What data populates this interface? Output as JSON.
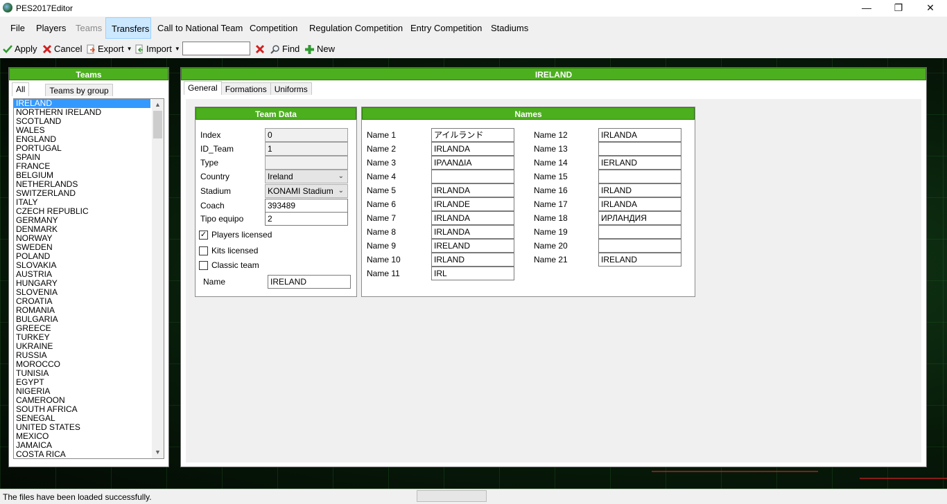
{
  "window": {
    "title": "PES2017Editor",
    "minimize": "—",
    "restore": "❐",
    "close": "✕"
  },
  "menu": {
    "file": "File",
    "players": "Players",
    "teams": "Teams",
    "transfers": "Transfers",
    "call_national": "Call to National Team",
    "competition": "Competition",
    "regulation": "Regulation Competition",
    "entry": "Entry Competition",
    "stadiums": "Stadiums"
  },
  "toolbar": {
    "apply": "Apply",
    "cancel": "Cancel",
    "export": "Export",
    "import": "Import",
    "search_value": "",
    "find": "Find",
    "new": "New"
  },
  "colors": {
    "accent": "#4caf1e",
    "selection": "#3399ff",
    "apply_icon": "#2e9a2e",
    "cancel_icon": "#d21f1f"
  },
  "teams_panel": {
    "title": "Teams",
    "tabs": [
      "All",
      "Teams by group"
    ],
    "items": [
      "IRELAND",
      "NORTHERN IRELAND",
      "SCOTLAND",
      "WALES",
      "ENGLAND",
      "PORTUGAL",
      "SPAIN",
      "FRANCE",
      "BELGIUM",
      "NETHERLANDS",
      "SWITZERLAND",
      "ITALY",
      "CZECH REPUBLIC",
      "GERMANY",
      "DENMARK",
      "NORWAY",
      "SWEDEN",
      "POLAND",
      "SLOVAKIA",
      "AUSTRIA",
      "HUNGARY",
      "SLOVENIA",
      "CROATIA",
      "ROMANIA",
      "BULGARIA",
      "GREECE",
      "TURKEY",
      "UKRAINE",
      "RUSSIA",
      "MOROCCO",
      "TUNISIA",
      "EGYPT",
      "NIGERIA",
      "CAMEROON",
      "SOUTH AFRICA",
      "SENEGAL",
      "UNITED STATES",
      "MEXICO",
      "JAMAICA",
      "COSTA RICA"
    ],
    "selected_index": 0
  },
  "main_panel": {
    "title": "IRELAND",
    "tabs": [
      "General",
      "Formations",
      "Uniforms"
    ]
  },
  "team_data": {
    "title": "Team Data",
    "index_label": "Index",
    "index_value": "0",
    "id_label": "ID_Team",
    "id_value": "1",
    "type_label": "Type",
    "type_value": "",
    "country_label": "Country",
    "country_value": "Ireland",
    "stadium_label": "Stadium",
    "stadium_value": "KONAMI Stadium",
    "coach_label": "Coach",
    "coach_value": "393489",
    "tipo_label": "Tipo equipo",
    "tipo_value": "2",
    "players_licensed": "Players licensed",
    "players_licensed_checked": true,
    "kits_licensed": "Kits licensed",
    "kits_licensed_checked": false,
    "classic_team": "Classic team",
    "classic_team_checked": false,
    "name_label": "Name",
    "name_value": "IRELAND"
  },
  "names": {
    "title": "Names",
    "col1": [
      {
        "label": "Name 1",
        "value": "アイルランド"
      },
      {
        "label": "Name 2",
        "value": "IRLANDA"
      },
      {
        "label": "Name 3",
        "value": "ΙΡΛΑΝΔΙΑ"
      },
      {
        "label": "Name 4",
        "value": ""
      },
      {
        "label": "Name 5",
        "value": "IRLANDA"
      },
      {
        "label": "Name 6",
        "value": "IRLANDE"
      },
      {
        "label": "Name 7",
        "value": "IRLANDA"
      },
      {
        "label": "Name 8",
        "value": "IRLANDA"
      },
      {
        "label": "Name 9",
        "value": "IRELAND"
      },
      {
        "label": "Name 10",
        "value": "IRLAND"
      },
      {
        "label": "Name 11",
        "value": "IRL"
      }
    ],
    "col2": [
      {
        "label": "Name 12",
        "value": "IRLANDA"
      },
      {
        "label": "Name 13",
        "value": ""
      },
      {
        "label": "Name 14",
        "value": "IERLAND"
      },
      {
        "label": "Name 15",
        "value": ""
      },
      {
        "label": "Name 16",
        "value": "IRLAND"
      },
      {
        "label": "Name 17",
        "value": "IRLANDA"
      },
      {
        "label": "Name 18",
        "value": "ИРЛАНДИЯ"
      },
      {
        "label": "Name 19",
        "value": ""
      },
      {
        "label": "Name 20",
        "value": ""
      },
      {
        "label": "Name 21",
        "value": "IRELAND"
      }
    ]
  },
  "status": {
    "message": "The files have been loaded successfully."
  }
}
